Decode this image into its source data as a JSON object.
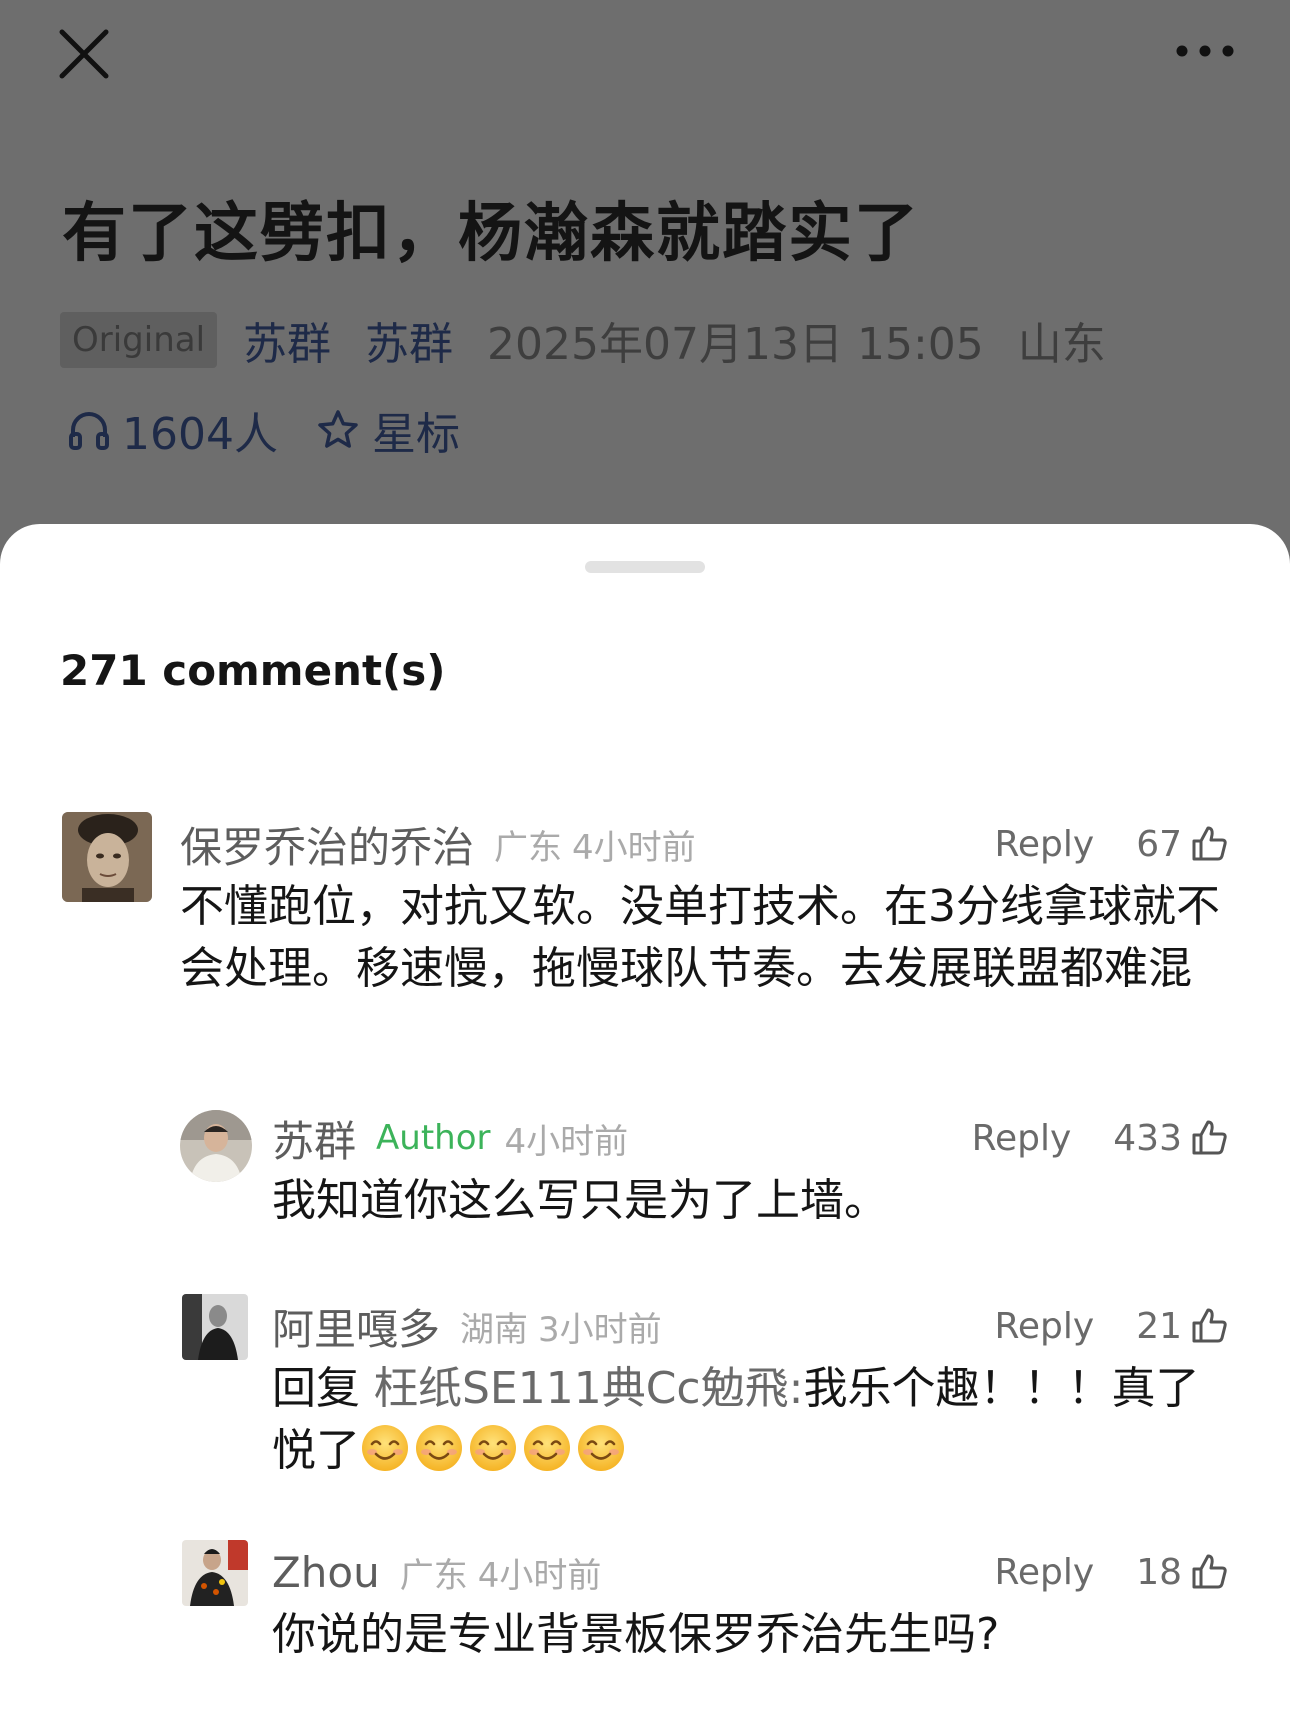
{
  "article": {
    "title": "有了这劈扣，杨瀚森就踏实了",
    "original_label": "Original",
    "author_primary": "苏群",
    "author_secondary": "苏群",
    "datetime": "2025年07月13日 15:05",
    "location": "山东",
    "listeners": "1604人",
    "star_label": "星标"
  },
  "sheet": {
    "title": "271 comment(s)"
  },
  "comments": [
    {
      "name": "保罗乔治的乔治",
      "location": "广东",
      "time": "4小时前",
      "reply_label": "Reply",
      "likes": "67",
      "text": "不懂跑位，对抗又软。没单打技术。在3分线拿球就不会处理。移速慢，拖慢球队节奏。去发展联盟都难混"
    },
    {
      "name": "苏群",
      "badge": "Author",
      "time": "4小时前",
      "reply_label": "Reply",
      "likes": "433",
      "text": "我知道你这么写只是为了上墙。"
    },
    {
      "name": "阿里嘎多",
      "location": "湖南",
      "time": "3小时前",
      "reply_label": "Reply",
      "likes": "21",
      "reply_prefix": "回复",
      "reply_to": "枉纸SE111典Cc勉飛:",
      "text": "我乐个趣！！！真了悦了",
      "emoji_count": 5
    },
    {
      "name": "Zhou",
      "location": "广东",
      "time": "4小时前",
      "reply_label": "Reply",
      "likes": "18",
      "text": "你说的是专业背景板保罗乔治先生吗?"
    }
  ],
  "icons": {
    "close": "close-icon",
    "more": "more-icon",
    "headphones": "headphones-icon",
    "star": "star-icon",
    "like": "thumbs-up-icon",
    "emoji": "smiling-face-icon"
  },
  "colors": {
    "author_badge": "#3cb35a",
    "link": "#1e2a48",
    "overlay": "#6e6e6e"
  }
}
